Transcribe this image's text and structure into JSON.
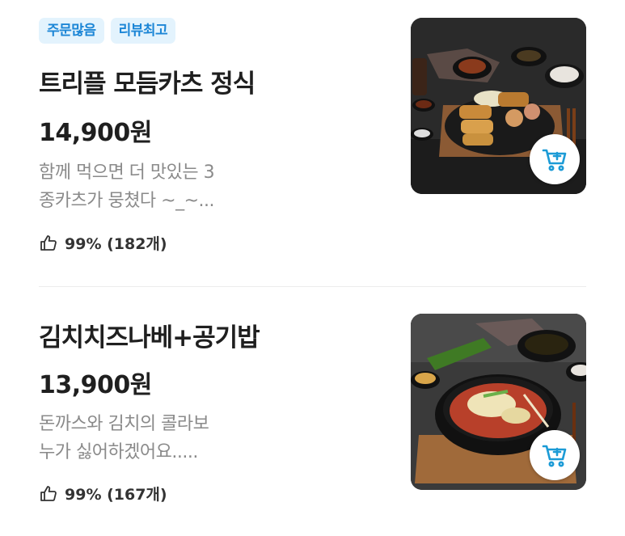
{
  "items": [
    {
      "tags": [
        "주문많음",
        "리뷰최고"
      ],
      "title": "트리플 모듬카츠 정식",
      "price": "14,900원",
      "desc_lines": [
        "함께 먹으면 더 맛있는 3",
        "종카츠가 뭉쳤다 ~_~..."
      ],
      "rating": "99% (182개)"
    },
    {
      "title": "김치치즈나베+공기밥",
      "price": "13,900원",
      "desc_lines": [
        "돈까스와 김치의 콜라보",
        "누가 싫어하겠어요....."
      ],
      "rating": "99% (167개)"
    }
  ],
  "colors": {
    "tag_bg": "#e3f3fd",
    "tag_text": "#1c86d6",
    "cart_icon": "#1c9bd6",
    "desc": "#8a8a8a"
  },
  "icons": {
    "like": "thumbs-up-icon",
    "cart": "add-to-cart-icon"
  }
}
